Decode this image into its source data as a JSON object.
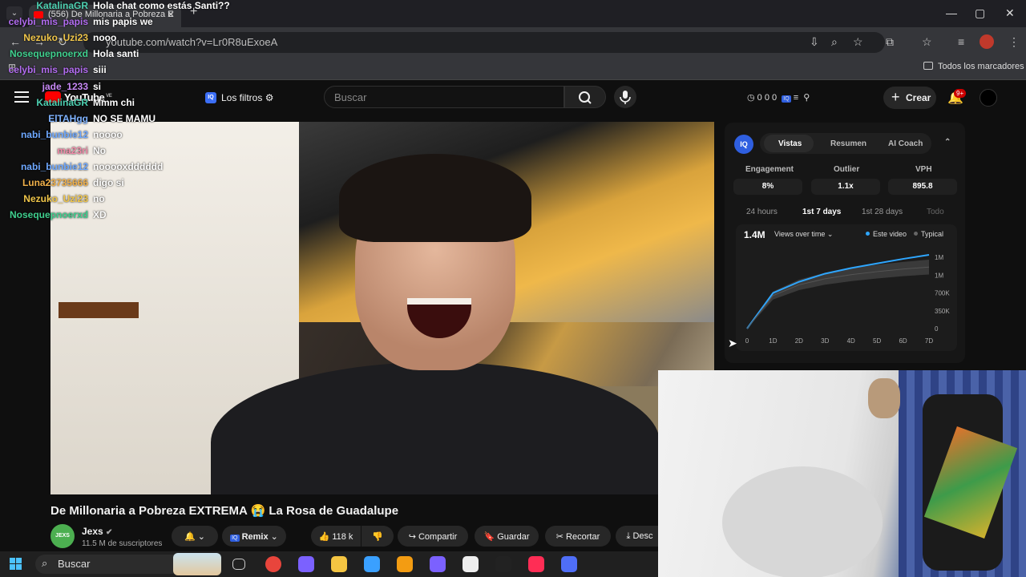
{
  "browser": {
    "tab_title": "(556) De Millonaria a Pobreza E",
    "tab_close": "✕",
    "new_tab": "+",
    "url": "youtube.com/watch?v=Lr0R8uExoeA",
    "bookmarks_folder": "Todos los marcadores",
    "window_controls": {
      "minimize": "—",
      "maximize": "▢",
      "close": "✕"
    }
  },
  "youtube": {
    "logo_text": "YouTube",
    "logo_region": "VE",
    "filters_label": "Los filtros",
    "iq_mark": "IQ",
    "search_placeholder": "Buscar",
    "header_stats": "0 0 0",
    "create_label": "Crear",
    "notif_badge": "9+"
  },
  "chat": [
    {
      "user": "KatalinaGR",
      "color": "#4ed1b2",
      "message": "Hola chat como estás Santi??"
    },
    {
      "user": "celybi_mis_papis",
      "color": "#b26cf0",
      "message": "mis papis we"
    },
    {
      "user": "Nezuko_Uzi23",
      "color": "#f0c64a",
      "message": "nooo"
    },
    {
      "user": "Nosequepnoerxd",
      "color": "#3fcf8e",
      "message": "Hola santi"
    },
    {
      "user": "celybi_mis_papis",
      "color": "#b26cf0",
      "message": "siii"
    },
    {
      "user": "jade_1233",
      "color": "#c788f5",
      "message": "si"
    },
    {
      "user": "KatalinaGR",
      "color": "#4ed1b2",
      "message": "Mmm chi"
    },
    {
      "user": "ElTAHgg",
      "color": "#7fb3ff",
      "message": "NO SE MAMU"
    },
    {
      "user": "nabi_bunbie12",
      "color": "#6ea8ff",
      "message": "noooo"
    },
    {
      "user": "ma23ri",
      "color": "#f08aa8",
      "message": "No"
    },
    {
      "user": "nabi_bunbie12",
      "color": "#6ea8ff",
      "message": "nooooxdddddd"
    },
    {
      "user": "Luna23735666",
      "color": "#f0b04a",
      "message": "digo si"
    },
    {
      "user": "Nezuko_Uzi23",
      "color": "#f0c64a",
      "message": "no"
    },
    {
      "user": "Nosequepnoerxd",
      "color": "#3fcf8e",
      "message": "XD"
    }
  ],
  "video": {
    "title": "De Millonaria a Pobreza EXTREMA 😭 La Rosa de Guadalupe",
    "channel": "Jexs",
    "channel_avatar": "JEXS",
    "subscribers": "11.5 M de suscriptores",
    "actions": {
      "remix": "Remix",
      "likes": "118 k",
      "share": "Compartir",
      "save": "Guardar",
      "clip": "Recortar",
      "download": "Desc"
    }
  },
  "iq_panel": {
    "logo": "IQ",
    "tabs": [
      "Vistas",
      "Resumen",
      "AI Coach"
    ],
    "active_tab": "Vistas",
    "metrics": [
      {
        "label": "Engagement",
        "value": "8%"
      },
      {
        "label": "Outlier",
        "value": "1.1x"
      },
      {
        "label": "VPH",
        "value": "895.8"
      }
    ],
    "ranges": [
      "24 hours",
      "1st 7 days",
      "1st 28 days",
      "Todo"
    ],
    "active_range": "1st 7 days",
    "views_total": "1.4M",
    "views_selector": "Views over time ⌄",
    "legend_this": "Este video",
    "legend_typical": "Typical",
    "accent": "#2ea6ff"
  },
  "chart_data": {
    "type": "line",
    "x": [
      "0",
      "1D",
      "2D",
      "3D",
      "4D",
      "5D",
      "6D",
      "7D"
    ],
    "y_ticks": [
      "0",
      "350K",
      "700K",
      "1M",
      "1M"
    ],
    "series": [
      {
        "name": "Este video",
        "values": [
          0,
          700000,
          920000,
          1080000,
          1190000,
          1280000,
          1370000,
          1450000
        ]
      },
      {
        "name": "Typical",
        "values": [
          0,
          650000,
          860000,
          980000,
          1060000,
          1120000,
          1170000,
          1210000
        ]
      }
    ],
    "ylim": [
      0,
      1450000
    ]
  },
  "taskbar": {
    "search_label": "Buscar",
    "icons": [
      "task-view-icon",
      "chrome-icon",
      "copilot-icon",
      "folder-icon",
      "store-icon",
      "media-icon",
      "messenger-icon",
      "capcut-icon",
      "obs-icon",
      "tiktok-icon",
      "app-icon"
    ]
  }
}
